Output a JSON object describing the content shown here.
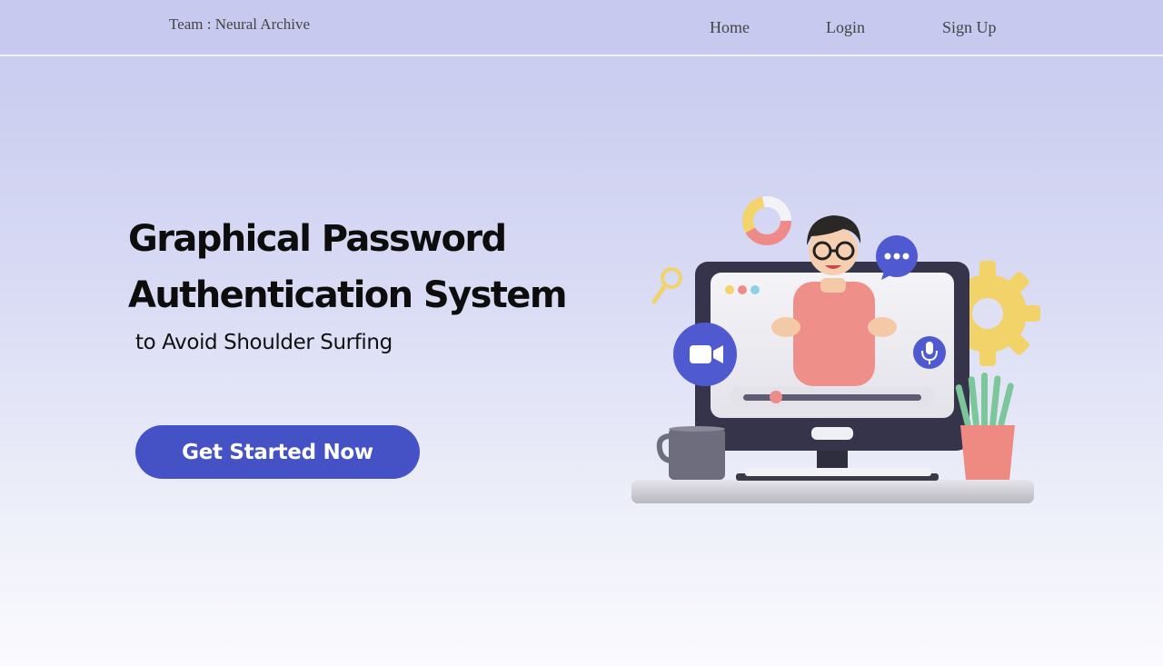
{
  "nav": {
    "brand": "Team : Neural Archive",
    "links": [
      "Home",
      "Login",
      "Sign Up"
    ]
  },
  "hero": {
    "title_line1": "Graphical Password",
    "title_line2": "Authentication System",
    "subtitle": "to Avoid Shoulder Surfing",
    "cta_label": "Get Started Now"
  },
  "colors": {
    "nav_background": "#c7caee",
    "cta_background": "#4552c6",
    "cta_text": "#ffffff",
    "title_text": "#0d0d0d"
  },
  "illustration": {
    "icons": [
      "donut-chart-icon",
      "chat-bubble-icon",
      "magnifier-icon",
      "video-camera-icon",
      "microphone-icon",
      "gear-icon",
      "coffee-mug-icon",
      "plant-icon"
    ]
  }
}
